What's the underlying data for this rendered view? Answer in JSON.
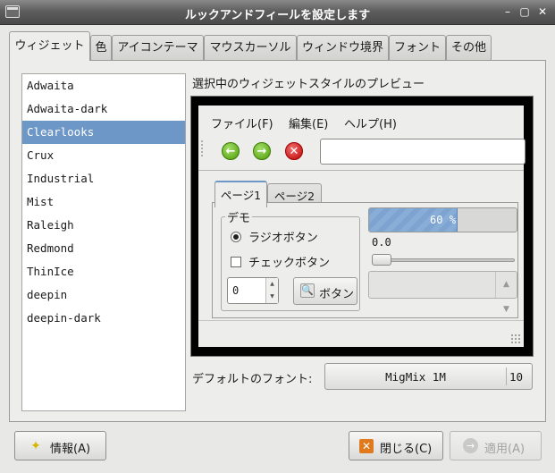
{
  "window": {
    "title": "ルックアンドフィールを設定します",
    "btn_minimize": "–",
    "btn_maximize": "▢",
    "btn_close": "✕"
  },
  "tabs": [
    {
      "label": "ウィジェット",
      "active": true
    },
    {
      "label": "色"
    },
    {
      "label": "アイコンテーマ"
    },
    {
      "label": "マウスカーソル"
    },
    {
      "label": "ウィンドウ境界"
    },
    {
      "label": "フォント"
    },
    {
      "label": "その他"
    }
  ],
  "themes": [
    "Adwaita",
    "Adwaita-dark",
    "Clearlooks",
    "Crux",
    "Industrial",
    "Mist",
    "Raleigh",
    "Redmond",
    "ThinIce",
    "deepin",
    "deepin-dark"
  ],
  "selected_theme": "Clearlooks",
  "preview": {
    "label": "選択中のウィジェットスタイルのプレビュー",
    "menu": [
      "ファイル(F)",
      "編集(E)",
      "ヘルプ(H)"
    ],
    "toolbar_entry_value": "",
    "page_tabs": [
      "ページ1",
      "ページ2"
    ],
    "frame_label": "デモ",
    "radio_label": "ラジオボタン",
    "check_label": "チェックボタン",
    "spin_value": "0",
    "button_label": "ボタン",
    "progress_text": "60 %",
    "progress_fraction": 0.6,
    "scale_value": "0.0",
    "combo_value": ""
  },
  "font": {
    "label": "デフォルトのフォント:",
    "name": "MigMix 1M",
    "size": "10"
  },
  "buttons": {
    "about": "情報(A)",
    "close": "閉じる(C)",
    "apply": "適用(A)"
  },
  "colors": {
    "accent": "#6d97c6",
    "titlebar": "#555555"
  }
}
